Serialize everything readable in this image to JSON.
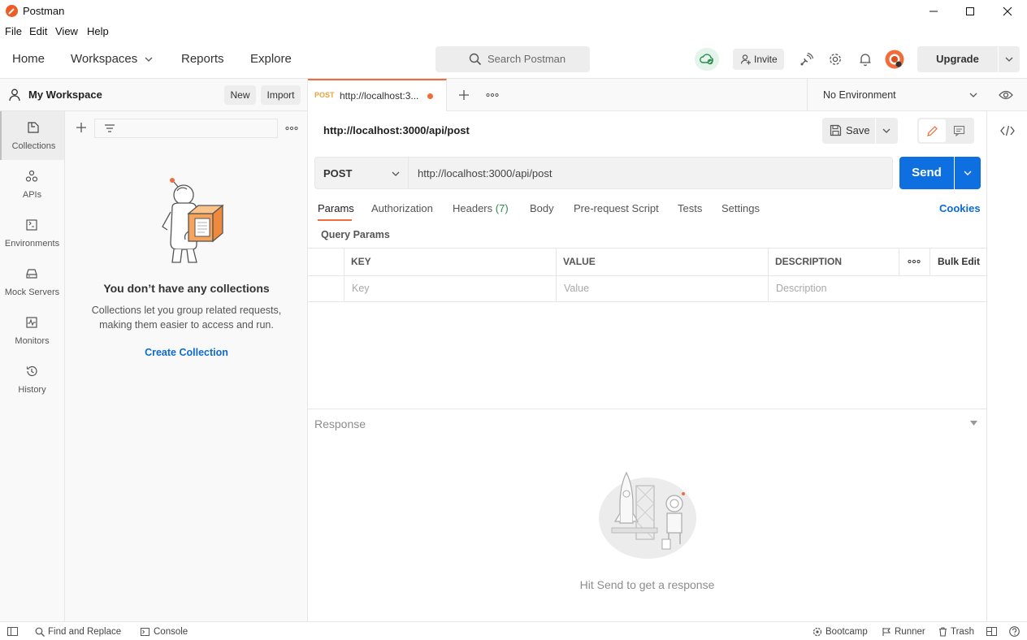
{
  "window": {
    "title": "Postman",
    "controls": [
      "minimize-icon",
      "maximize-icon",
      "close-icon"
    ]
  },
  "menu": [
    "File",
    "Edit",
    "View",
    "Help"
  ],
  "header": {
    "nav": [
      "Home",
      "Workspaces",
      "Reports",
      "Explore"
    ],
    "search_placeholder": "Search Postman",
    "invite_label": "Invite",
    "upgrade_label": "Upgrade",
    "icons": [
      "cloud-sync-icon",
      "satellite-icon",
      "gear-icon",
      "bell-icon",
      "avatar"
    ]
  },
  "workspace": {
    "name": "My Workspace",
    "new_label": "New",
    "import_label": "Import"
  },
  "rail": [
    {
      "label": "Collections",
      "icon": "collections-icon",
      "active": true
    },
    {
      "label": "APIs",
      "icon": "apis-icon"
    },
    {
      "label": "Environments",
      "icon": "environments-icon"
    },
    {
      "label": "Mock Servers",
      "icon": "mock-servers-icon"
    },
    {
      "label": "Monitors",
      "icon": "monitors-icon"
    },
    {
      "label": "History",
      "icon": "history-icon"
    }
  ],
  "collections": {
    "empty_title": "You don’t have any collections",
    "empty_desc": "Collections let you group related requests, making them easier to access and run.",
    "create_label": "Create Collection"
  },
  "tab": {
    "method": "POST",
    "url_short": "http://localhost:3...",
    "environment": "No Environment"
  },
  "request": {
    "name": "http://localhost:3000/api/post",
    "method": "POST",
    "url": "http://localhost:3000/api/post",
    "save_label": "Save",
    "send_label": "Send",
    "tabs": {
      "params": "Params",
      "authorization": "Authorization",
      "headers": "Headers",
      "headers_count": "(7)",
      "body": "Body",
      "prerequest": "Pre-request Script",
      "tests": "Tests",
      "settings": "Settings"
    },
    "cookies_label": "Cookies",
    "query_params_title": "Query Params",
    "table": {
      "headers": [
        "KEY",
        "VALUE",
        "DESCRIPTION"
      ],
      "bulk_edit": "Bulk Edit",
      "placeholders": [
        "Key",
        "Value",
        "Description"
      ]
    }
  },
  "response": {
    "title": "Response",
    "empty_text": "Hit Send to get a response"
  },
  "statusbar": {
    "find_replace": "Find and Replace",
    "console": "Console",
    "bootcamp": "Bootcamp",
    "runner": "Runner",
    "trash": "Trash"
  },
  "colors": {
    "accent": "#f26b3a",
    "send_blue": "#0d6fe0",
    "link_blue": "#0b6ad8",
    "count_green": "#2c8a4e"
  }
}
